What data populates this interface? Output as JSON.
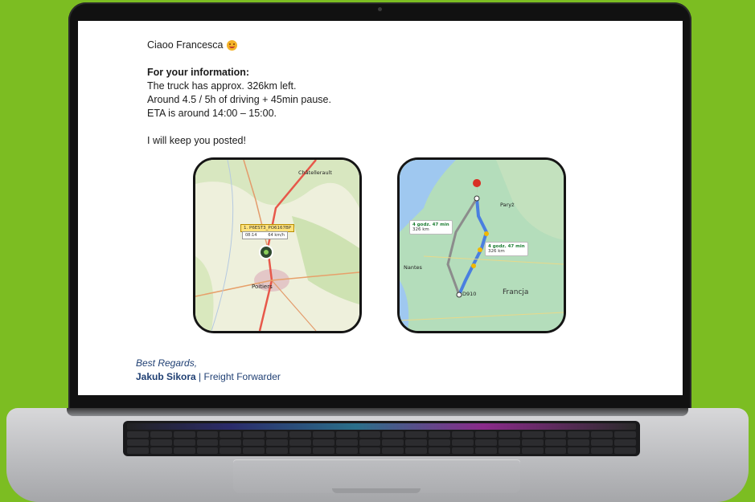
{
  "email": {
    "greeting": "Ciaoo Francesca",
    "info_heading": "For your information:",
    "lines": [
      "The truck has approx. 326km left.",
      "Around 4.5 / 5h of driving + 45min pause.",
      "ETA is around 14:00 – 15:00."
    ],
    "closing": "I will keep you posted!"
  },
  "map_tracker": {
    "city_top": "Châtellerault",
    "city_bottom": "Poitiers",
    "vehicle_tag": "1. P6EST3_PO6167BP",
    "time": "08:14",
    "speed": "64 km/h"
  },
  "map_route": {
    "country_label": "Francja",
    "city_paris": "Paryż",
    "city_nantes": "Nantes",
    "route_a_time": "4 godz. 47 min",
    "route_a_dist": "326 km",
    "route_b_time": "4 godz. 47 min",
    "route_b_dist": "326 km",
    "start_label": "D910"
  },
  "signature": {
    "regards": "Best Regards,",
    "name": "Jakub Sikora",
    "separator": "|",
    "role": "Freight Forwarder"
  },
  "colors": {
    "background": "#7cbd22",
    "signature": "#1f3f73",
    "route_blue": "#4a7fe0"
  }
}
